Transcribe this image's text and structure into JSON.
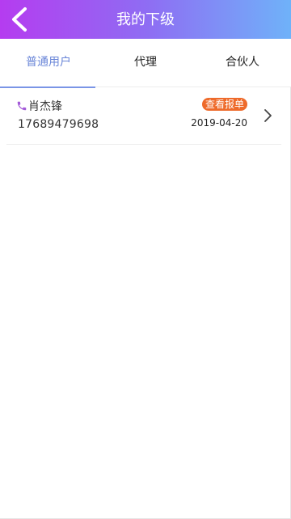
{
  "header": {
    "title": "我的下级",
    "back_icon": "chevron-left-icon",
    "gradient": [
      "#b53cf0",
      "#8f6cf3",
      "#6fb2f9"
    ]
  },
  "tabs": [
    {
      "label": "普通用户",
      "active": true
    },
    {
      "label": "代理",
      "active": false
    },
    {
      "label": "合伙人",
      "active": false
    }
  ],
  "colors": {
    "active_tab": "#6a86d8",
    "badge": "#ee6a2a",
    "phone_icon": "#a35ad8"
  },
  "members": [
    {
      "name": "肖杰锋",
      "phone": "17689479698",
      "badge_label": "查看报单",
      "date": "2019-04-20",
      "icon": "phone-icon"
    }
  ]
}
